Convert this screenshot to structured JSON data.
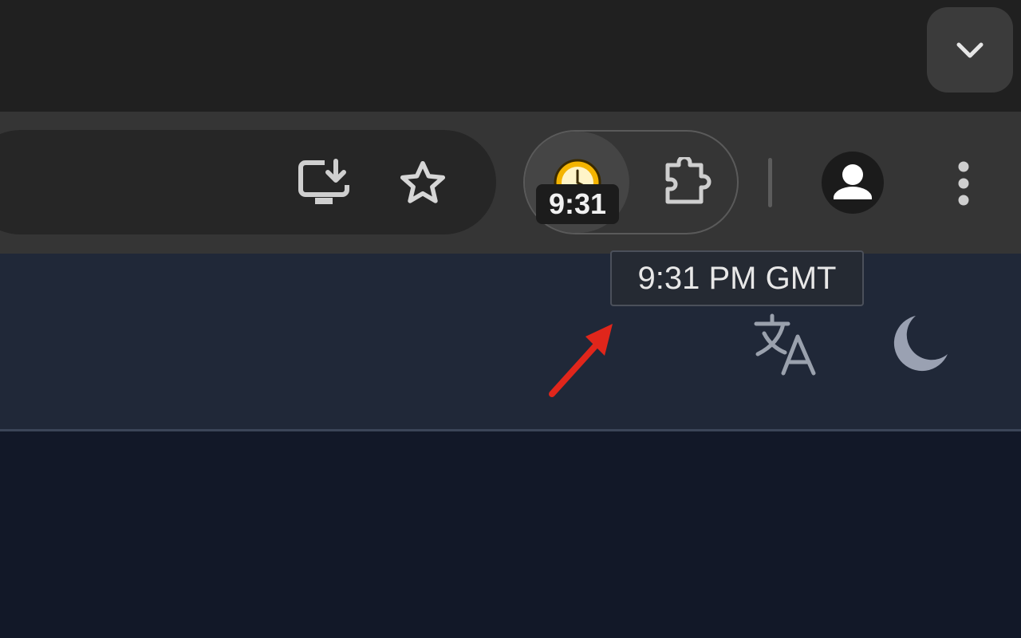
{
  "browser": {
    "tab_strip": {
      "tab_search_icon": "chevron-down-icon"
    },
    "toolbar": {
      "omnibox_actions": [
        {
          "name": "install-app",
          "icon": "monitor-download-icon"
        },
        {
          "name": "bookmark",
          "icon": "star-icon"
        }
      ],
      "extension": {
        "icon": "clock-icon",
        "badge_text": "9:31",
        "tooltip": "9:31 PM GMT"
      },
      "extensions_menu_icon": "puzzle-icon",
      "profile_icon": "person-icon",
      "menu_icon": "kebab-menu-icon"
    }
  },
  "page": {
    "header_icons": [
      "translate-icon",
      "moon-icon"
    ]
  },
  "annotation": {
    "arrow_color": "#e0261b"
  },
  "colors": {
    "tabstrip_bg": "#202020",
    "toolbar_bg": "#353535",
    "page_header_bg": "#202838",
    "page_body_bg": "#121828"
  }
}
